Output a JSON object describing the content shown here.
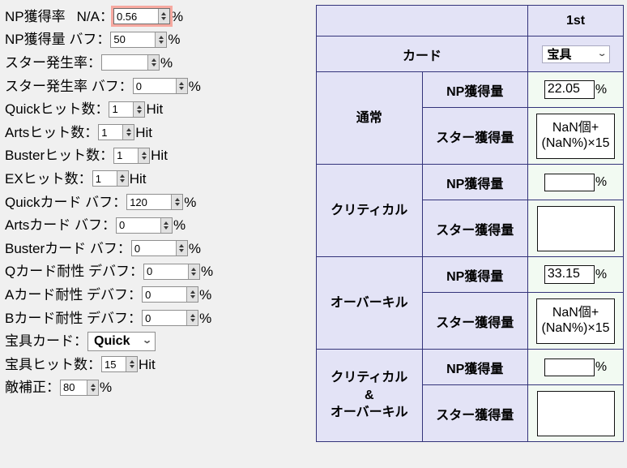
{
  "theme": {
    "page_bg": "#f0f0f0",
    "table_header_bg": "#e3e3f6",
    "table_value_bg": "#f2faf2",
    "table_border": "#33337a",
    "focus_ring": "#f7a9a0"
  },
  "form": {
    "rows": [
      {
        "id": "np-gain-rate",
        "label_a": "NP獲得率",
        "label_b": "N/A：",
        "value": "0.56",
        "suffix": "%",
        "widget": "spinner",
        "width_class": "w-np",
        "focused": true
      },
      {
        "id": "np-gain-buff",
        "label_a": "NP獲得量 バフ：",
        "value": "50",
        "suffix": "%",
        "widget": "spinner",
        "width_class": "w-pct",
        "focused": false
      },
      {
        "id": "star-rate",
        "label_a": "スター発生率：",
        "value": "",
        "suffix": "%",
        "widget": "spinner",
        "width_class": "w-star",
        "focused": false
      },
      {
        "id": "star-rate-buff",
        "label_a": "スター発生率 バフ：",
        "value": "0",
        "suffix": "%",
        "widget": "spinner",
        "width_class": "w-pct-s",
        "focused": false
      },
      {
        "id": "quick-hits",
        "label_a": "Quickヒット数：",
        "value": "1",
        "suffix": "Hit",
        "widget": "spinner",
        "width_class": "w-hit",
        "focused": false
      },
      {
        "id": "arts-hits",
        "label_a": "Artsヒット数：",
        "value": "1",
        "suffix": "Hit",
        "widget": "spinner",
        "width_class": "w-hit",
        "focused": false
      },
      {
        "id": "buster-hits",
        "label_a": "Busterヒット数：",
        "value": "1",
        "suffix": "Hit",
        "widget": "spinner",
        "width_class": "w-hit",
        "focused": false
      },
      {
        "id": "ex-hits",
        "label_a": "EXヒット数：",
        "value": "1",
        "suffix": "Hit",
        "widget": "spinner",
        "width_class": "w-hit",
        "focused": false
      },
      {
        "id": "quick-card-buff",
        "label_a": "Quickカード バフ：",
        "value": "120",
        "suffix": "%",
        "widget": "spinner",
        "width_class": "w-pct",
        "focused": false
      },
      {
        "id": "arts-card-buff",
        "label_a": "Artsカード バフ：",
        "value": "0",
        "suffix": "%",
        "widget": "spinner",
        "width_class": "w-pct",
        "focused": false
      },
      {
        "id": "buster-card-buff",
        "label_a": "Busterカード バフ：",
        "value": "0",
        "suffix": "%",
        "widget": "spinner",
        "width_class": "w-pct",
        "focused": false
      },
      {
        "id": "q-card-resist-debuff",
        "label_a": "Qカード耐性 デバフ：",
        "value": "0",
        "suffix": "%",
        "widget": "spinner",
        "width_class": "w-pct",
        "focused": false
      },
      {
        "id": "a-card-resist-debuff",
        "label_a": "Aカード耐性 デバフ：",
        "value": "0",
        "suffix": "%",
        "widget": "spinner",
        "width_class": "w-pct",
        "focused": false
      },
      {
        "id": "b-card-resist-debuff",
        "label_a": "Bカード耐性 デバフ：",
        "value": "0",
        "suffix": "%",
        "widget": "spinner",
        "width_class": "w-pct",
        "focused": false
      },
      {
        "id": "np-card-type",
        "label_a": "宝具カード：",
        "value": "Quick",
        "suffix": "",
        "widget": "select",
        "options": [
          "Quick",
          "Arts",
          "Buster"
        ],
        "focused": false
      },
      {
        "id": "np-hits",
        "label_a": "宝具ヒット数：",
        "value": "15",
        "suffix": "Hit",
        "widget": "spinner",
        "width_class": "w-hit",
        "focused": false
      },
      {
        "id": "enemy-correction",
        "label_a": "敵補正：",
        "value": "80",
        "suffix": "%",
        "widget": "spinner",
        "width_class": "w-enemy",
        "focused": false
      }
    ]
  },
  "table": {
    "corner_label": "",
    "column_header": "1st",
    "card_row_label": "カード",
    "card_select_value": "宝具",
    "card_select_options": [
      "宝具",
      "Quick",
      "Arts",
      "Buster",
      "EX"
    ],
    "metric_np": "NP獲得量",
    "metric_star": "スター獲得量",
    "pct_mark": "%",
    "groups": [
      {
        "label": "通常",
        "np_value": "22.05",
        "np_unit": "%",
        "star_line1": "NaN個+",
        "star_line2": "(NaN%)×15"
      },
      {
        "label": "クリティカル",
        "np_value": "",
        "np_unit": "%",
        "star_line1": "",
        "star_line2": ""
      },
      {
        "label": "オーバーキル",
        "np_value": "33.15",
        "np_unit": "%",
        "star_line1": "NaN個+",
        "star_line2": "(NaN%)×15"
      },
      {
        "label": "クリティカル\n&\nオーバーキル",
        "np_value": "",
        "np_unit": "%",
        "star_line1": "",
        "star_line2": ""
      }
    ]
  }
}
